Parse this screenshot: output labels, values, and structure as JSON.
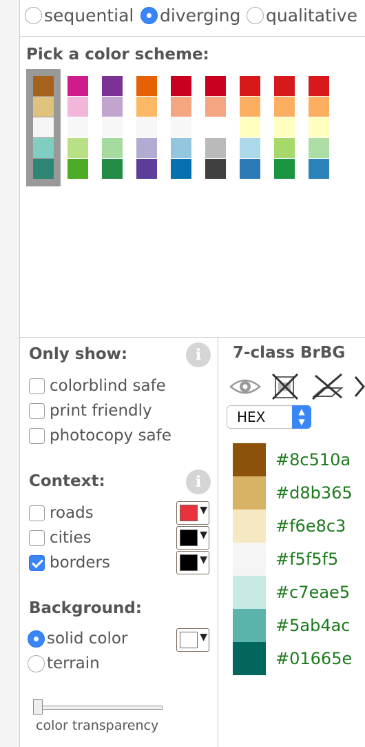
{
  "scheme_types": [
    {
      "label": "sequential",
      "selected": false
    },
    {
      "label": "diverging",
      "selected": true
    },
    {
      "label": "qualitative",
      "selected": false
    }
  ],
  "pick_title": "Pick a color scheme:",
  "schemes": [
    [
      "#a6611a",
      "#dfc27d",
      "#f5f5f5",
      "#80cdc1",
      "#2d8573"
    ],
    [
      "#d01c8b",
      "#f1b6da",
      "#f7f7f7",
      "#b8e186",
      "#4dac26"
    ],
    [
      "#7b3294",
      "#c2a5cf",
      "#f7f7f7",
      "#a6dba0",
      "#238b45"
    ],
    [
      "#e66101",
      "#fdb863",
      "#f7f7f7",
      "#b2abd2",
      "#5e3c99"
    ],
    [
      "#ca0020",
      "#f4a582",
      "#f7f7f7",
      "#92c5de",
      "#0571b0"
    ],
    [
      "#ca0020",
      "#f4a582",
      "#ffffff",
      "#bababa",
      "#404040"
    ],
    [
      "#d7191c",
      "#fdae61",
      "#ffffbf",
      "#abd9e9",
      "#2c7bb6"
    ],
    [
      "#d7191c",
      "#fdae61",
      "#ffffbf",
      "#a6d96a",
      "#1a9641"
    ],
    [
      "#d7191c",
      "#fdae61",
      "#ffffbf",
      "#abdda4",
      "#2b83ba"
    ]
  ],
  "only_show": {
    "title": "Only show:",
    "info": "i",
    "options": [
      {
        "label": "colorblind safe",
        "checked": false
      },
      {
        "label": "print friendly",
        "checked": false
      },
      {
        "label": "photocopy safe",
        "checked": false
      }
    ]
  },
  "context": {
    "title": "Context:",
    "info": "i",
    "options": [
      {
        "label": "roads",
        "checked": false,
        "color": "#e8323c"
      },
      {
        "label": "cities",
        "checked": false,
        "color": "#000000"
      },
      {
        "label": "borders",
        "checked": true,
        "color": "#000000"
      }
    ]
  },
  "background": {
    "title": "Background:",
    "options": [
      {
        "label": "solid color",
        "selected": true
      },
      {
        "label": "terrain",
        "selected": false
      }
    ],
    "color": "#ffffff",
    "transparency_label": "color transparency",
    "transparency": 0
  },
  "result": {
    "title": "7-class BrBG",
    "icons": [
      "eye-icon",
      "printer-crossed-icon",
      "photocopy-crossed-icon",
      "laptop-crossed-icon"
    ],
    "format": "HEX",
    "colors": [
      "#8c510a",
      "#d8b365",
      "#f6e8c3",
      "#f5f5f5",
      "#c7eae5",
      "#5ab4ac",
      "#01665e"
    ]
  }
}
